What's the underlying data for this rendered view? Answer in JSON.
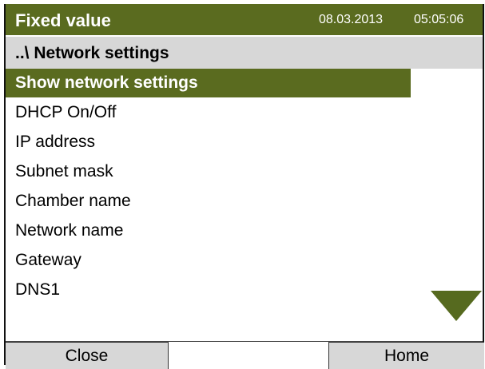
{
  "header": {
    "title": "Fixed value",
    "date": "08.03.2013",
    "time": "05:05:06"
  },
  "breadcrumb": "..\\ Network settings",
  "menu": {
    "items": [
      {
        "label": "Show network settings",
        "selected": true
      },
      {
        "label": "DHCP On/Off"
      },
      {
        "label": "IP address"
      },
      {
        "label": "Subnet mask"
      },
      {
        "label": "Chamber name"
      },
      {
        "label": "Network name"
      },
      {
        "label": "Gateway"
      },
      {
        "label": "DNS1"
      }
    ]
  },
  "scroll": {
    "icon": "scroll-down-triangle-icon",
    "color": "#566a1f"
  },
  "footer": {
    "close_label": "Close",
    "home_label": "Home"
  },
  "colors": {
    "accent": "#5a6b1f",
    "panel_gray": "#d7d7d7"
  }
}
